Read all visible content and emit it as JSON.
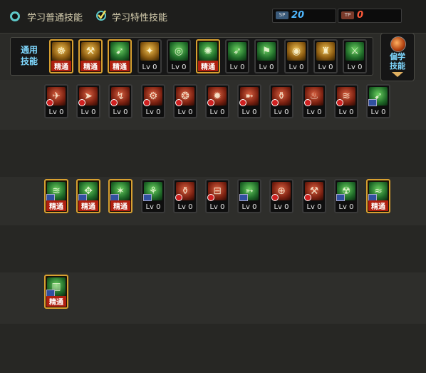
{
  "tabs": {
    "normal_label": "学习普通技能",
    "trait_label": "学习特性技能"
  },
  "counters": {
    "sp_icon": "SP",
    "sp_value": "20",
    "tp_icon": "TP",
    "tp_value": "0",
    "sp_color": "#4fb8ff",
    "tp_color": "#ff5a3a"
  },
  "category": {
    "label_line1": "通用",
    "label_line2": "技能",
    "side_line1": "偏学",
    "side_line2": "技能"
  },
  "rows": {
    "common": [
      {
        "level": "精通",
        "icon": "gold",
        "glyph": "☸"
      },
      {
        "level": "精通",
        "icon": "gold",
        "glyph": "⚒"
      },
      {
        "level": "精通",
        "icon": "green",
        "glyph": "➹"
      },
      {
        "level": "Lv 0",
        "icon": "gold",
        "glyph": "✦"
      },
      {
        "level": "Lv 0",
        "icon": "green",
        "glyph": "◎"
      },
      {
        "level": "精通",
        "icon": "green",
        "glyph": "✺"
      },
      {
        "level": "Lv 0",
        "icon": "green",
        "glyph": "➶"
      },
      {
        "level": "Lv 0",
        "icon": "green",
        "glyph": "⚑"
      },
      {
        "level": "Lv 0",
        "icon": "gold",
        "glyph": "◉"
      },
      {
        "level": "Lv 0",
        "icon": "gold",
        "glyph": "♜"
      },
      {
        "level": "Lv 0",
        "icon": "green",
        "glyph": "⚔"
      }
    ],
    "row1": [
      {
        "level": "Lv 0",
        "icon": "red",
        "glyph": "✈",
        "badge": "red"
      },
      {
        "level": "Lv 0",
        "icon": "red",
        "glyph": "➤",
        "badge": "red"
      },
      {
        "level": "Lv 0",
        "icon": "red",
        "glyph": "↯",
        "badge": "red"
      },
      {
        "level": "Lv 0",
        "icon": "red",
        "glyph": "⚙",
        "badge": "red"
      },
      {
        "level": "Lv 0",
        "icon": "red",
        "glyph": "❂",
        "badge": "red"
      },
      {
        "level": "Lv 0",
        "icon": "red",
        "glyph": "✹",
        "badge": "red"
      },
      {
        "level": "Lv 0",
        "icon": "red",
        "glyph": "➼",
        "badge": "red"
      },
      {
        "level": "Lv 0",
        "icon": "red",
        "glyph": "⚱",
        "badge": "red"
      },
      {
        "level": "Lv 0",
        "icon": "red",
        "glyph": "♨",
        "badge": "red"
      },
      {
        "level": "Lv 0",
        "icon": "red",
        "glyph": "≋",
        "badge": "red"
      },
      {
        "level": "Lv 0",
        "icon": "green",
        "glyph": "➹",
        "badge": "sx"
      }
    ],
    "row2": [
      {
        "level": "精通",
        "icon": "green",
        "glyph": "≋",
        "badge": "sx"
      },
      {
        "level": "精通",
        "icon": "green",
        "glyph": "✥",
        "badge": "sx"
      },
      {
        "level": "精通",
        "icon": "green",
        "glyph": "✶",
        "badge": "sx"
      },
      {
        "level": "Lv 0",
        "icon": "green",
        "glyph": "⚘",
        "badge": "sx"
      },
      {
        "level": "Lv 0",
        "icon": "red",
        "glyph": "⚱",
        "badge": "red"
      },
      {
        "level": "Lv 0",
        "icon": "red",
        "glyph": "⊟",
        "badge": "red"
      },
      {
        "level": "Lv 0",
        "icon": "green",
        "glyph": "➳",
        "badge": "sx"
      },
      {
        "level": "Lv 0",
        "icon": "red",
        "glyph": "⊕",
        "badge": "red"
      },
      {
        "level": "Lv 0",
        "icon": "red",
        "glyph": "⚒",
        "badge": "red"
      },
      {
        "level": "Lv 0",
        "icon": "green",
        "glyph": "☢",
        "badge": "sx"
      },
      {
        "level": "精通",
        "icon": "green",
        "glyph": "≈",
        "badge": "sx"
      }
    ],
    "row3": [
      {
        "level": "精通",
        "icon": "green",
        "glyph": "▥",
        "badge": "sx"
      }
    ]
  }
}
